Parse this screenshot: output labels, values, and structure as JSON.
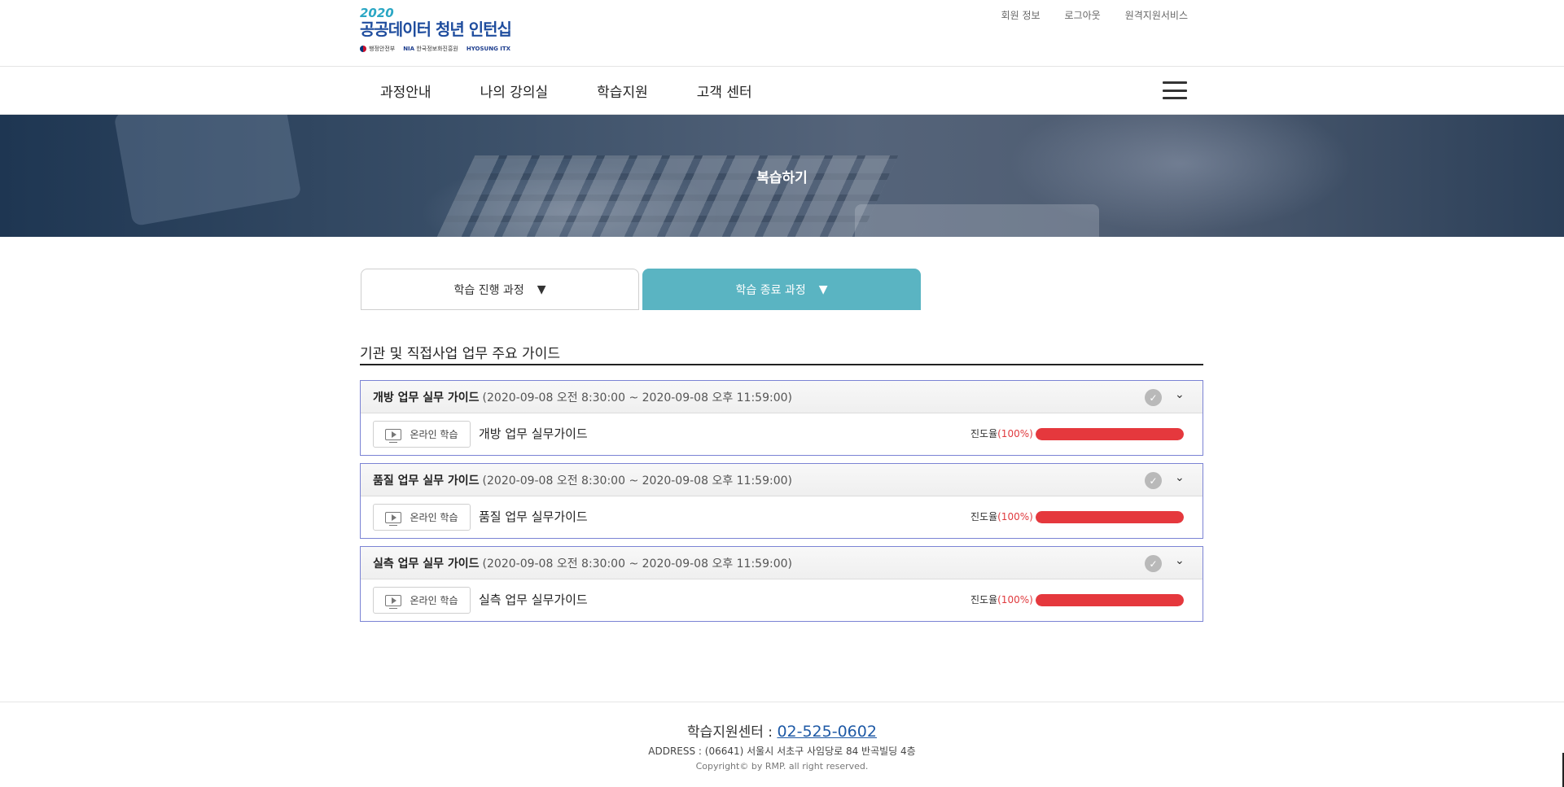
{
  "header": {
    "logo": {
      "year": "2020",
      "title": "공공데이터 청년 인턴십",
      "partners": [
        "행정안전부",
        "NIA",
        "한국정보화진흥원",
        "HYOSUNG ITX"
      ]
    },
    "util": [
      "회원 정보",
      "로그아웃",
      "원격지원서비스"
    ],
    "menu": [
      "과정안내",
      "나의 강의실",
      "학습지원",
      "고객 센터"
    ]
  },
  "banner": {
    "title": "복습하기"
  },
  "tabs": [
    {
      "label": "학습 진행 과정",
      "active": false
    },
    {
      "label": "학습 종료 과정",
      "active": true
    }
  ],
  "section_title": "기관 및 직접사업 업무 주요 가이드",
  "courses": [
    {
      "name": "개방 업무 실무 가이드",
      "period": "(2020-09-08 오전 8:30:00 ~ 2020-09-08 오후 11:59:00)",
      "button": "온라인 학습",
      "lesson": "개방 업무 실무가이드",
      "progress_label": "진도율",
      "progress_text": "(100%)",
      "progress": 100
    },
    {
      "name": "품질 업무 실무 가이드",
      "period": "(2020-09-08 오전 8:30:00 ~ 2020-09-08 오후 11:59:00)",
      "button": "온라인 학습",
      "lesson": "품질 업무 실무가이드",
      "progress_label": "진도율",
      "progress_text": "(100%)",
      "progress": 100
    },
    {
      "name": "실측 업무 실무 가이드",
      "period": "(2020-09-08 오전 8:30:00 ~ 2020-09-08 오후 11:59:00)",
      "button": "온라인 학습",
      "lesson": "실측 업무 실무가이드",
      "progress_label": "진도율",
      "progress_text": "(100%)",
      "progress": 100
    }
  ],
  "footer": {
    "center_label": "학습지원센터 :",
    "tel": "02-525-0602",
    "address": "ADDRESS : (06641) 서울시 서초구 사임당로 84 반곡빌딩 4층",
    "copyright": "Copyright© by RMP. all right reserved."
  },
  "colors": {
    "accent": "#5ab4c2",
    "brand": "#1f4d9e",
    "progress": "#e5383d",
    "card_border": "#7b83d4"
  }
}
